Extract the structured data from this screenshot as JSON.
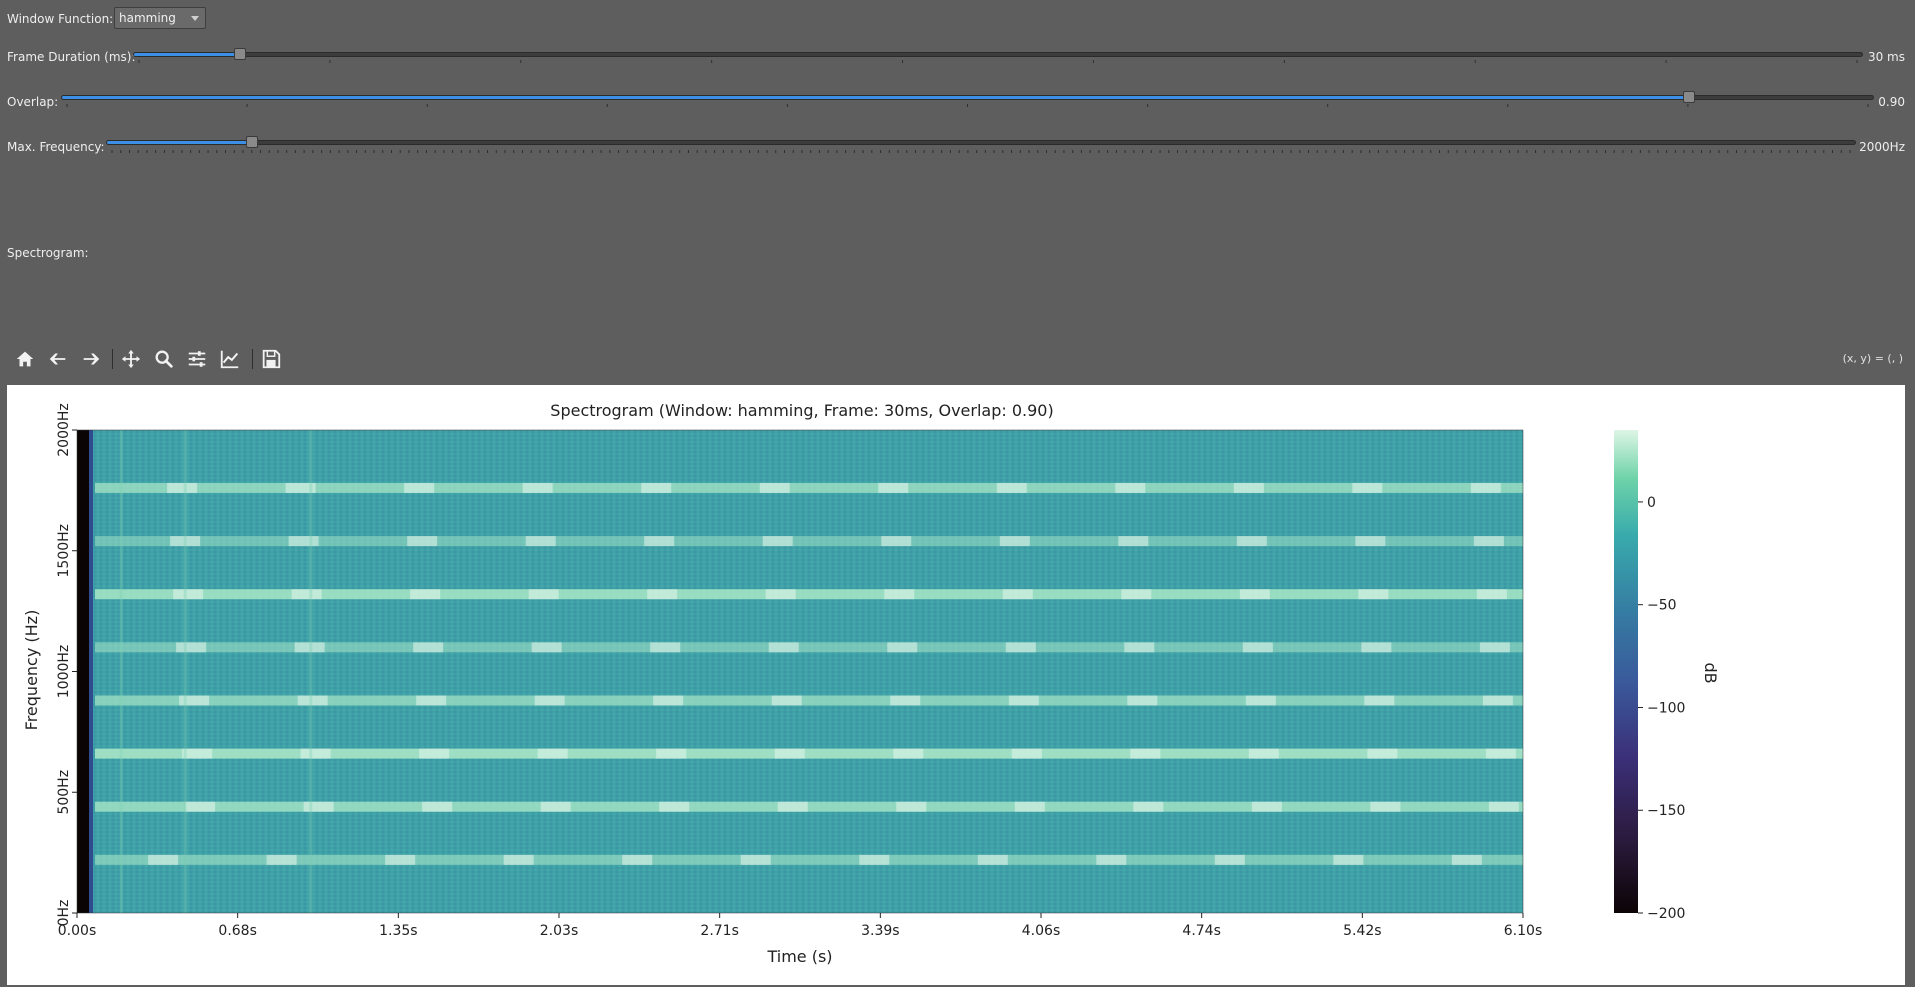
{
  "controls": {
    "window_function_label": "Window Function:",
    "window_function_value": "hamming",
    "frame_duration_label": "Frame Duration (ms):",
    "frame_duration_value": "30 ms",
    "frame_duration_fraction": 0.058,
    "overlap_label": "Overlap:",
    "overlap_value": "0.90",
    "overlap_fraction": 0.9,
    "max_freq_label": "Max. Frequency:",
    "max_freq_value": "2000Hz",
    "max_freq_fraction": 0.08,
    "spectrogram_label": "Spectrogram:"
  },
  "toolbar": {
    "icons": [
      "home-icon",
      "back-icon",
      "forward-icon",
      "pan-icon",
      "zoom-icon",
      "configure-icon",
      "edit-axes-icon",
      "save-icon"
    ],
    "coords": "(x, y) = (, )"
  },
  "chart_data": {
    "type": "heatmap",
    "title": "Spectrogram (Window: hamming, Frame: 30ms, Overlap: 0.90)",
    "xlabel": "Time (s)",
    "ylabel": "Frequency (Hz)",
    "x_ticks": [
      "0.00s",
      "0.68s",
      "1.35s",
      "2.03s",
      "2.71s",
      "3.39s",
      "4.06s",
      "4.74s",
      "5.42s",
      "6.10s"
    ],
    "y_ticks": [
      "0Hz",
      "500Hz",
      "1000Hz",
      "1500Hz",
      "2000Hz"
    ],
    "xlim": [
      0,
      6.1
    ],
    "ylim": [
      0,
      2000
    ],
    "harmonic_bands_hz": [
      220,
      440,
      660,
      880,
      1100,
      1320,
      1540,
      1760
    ],
    "colorbar": {
      "label": "dB",
      "ticks": [
        "0",
        "−50",
        "−100",
        "−150",
        "−200"
      ],
      "tick_values": [
        0,
        -50,
        -100,
        -150,
        -200
      ],
      "range": [
        -200,
        35
      ],
      "colormap": "mako"
    }
  }
}
